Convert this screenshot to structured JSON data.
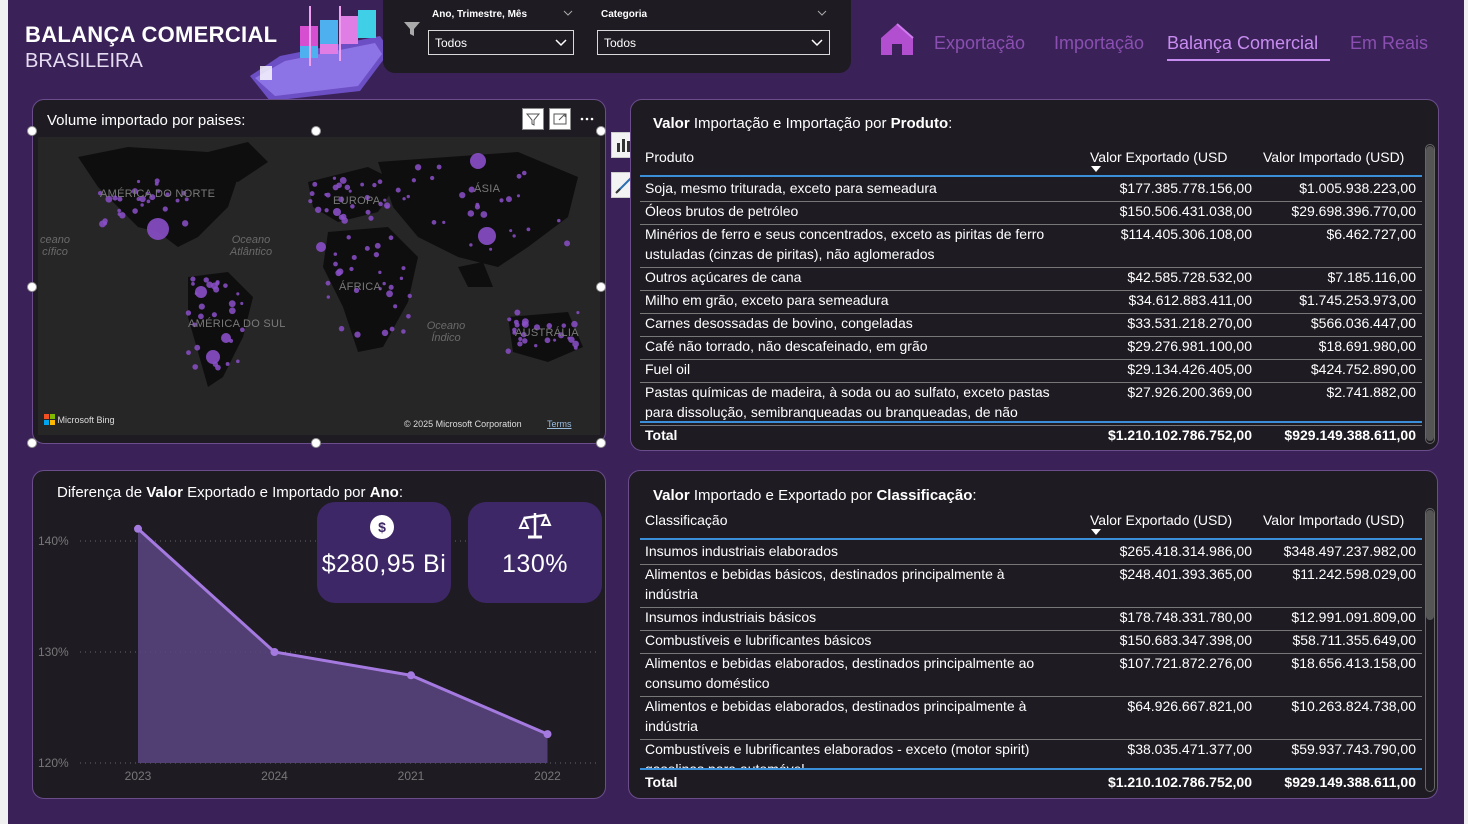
{
  "header": {
    "title_line1": "BALANÇA COMERCIAL",
    "title_line2": "BRASILEIRA"
  },
  "filters": {
    "date_label": "Ano, Trimestre, Mês",
    "date_value": "Todos",
    "category_label": "Categoria",
    "category_value": "Todos"
  },
  "nav": {
    "items": [
      {
        "label": "Exportação",
        "active": false
      },
      {
        "label": "Importação",
        "active": false
      },
      {
        "label": "Balança Comercial",
        "active": true
      },
      {
        "label": "Em Reais",
        "active": false
      }
    ]
  },
  "map": {
    "title": "Volume importado por paises:",
    "labels": [
      "AMÉRICA DO NORTE",
      "EUROPA",
      "ÁSIA",
      "ÁFRICA",
      "AMÉRICA DO SUL",
      "AUSTRÁLIA"
    ],
    "ocean_labels": [
      "Oceano Atlântico",
      "Oceano Índico",
      "ceano cífico"
    ],
    "attribution_bing": "Microsoft Bing",
    "attribution_copyright": "© 2025 Microsoft Corporation",
    "attribution_terms": "Terms",
    "dot_color": "#8a4fc8"
  },
  "products_table": {
    "title_bold1": "Valor",
    "title_mid": " Importação e Importação por ",
    "title_bold2": "Produto",
    "title_end": ":",
    "col_product": "Produto",
    "col_export": "Valor Exportado (USD",
    "col_import": "Valor Importado (USD)",
    "rows": [
      {
        "name": "Soja, mesmo triturada, exceto para semeadura",
        "name2": "",
        "export": "$177.385.778.156,00",
        "import": "$1.005.938.223,00"
      },
      {
        "name": "Óleos brutos de petróleo",
        "name2": "",
        "export": "$150.506.431.038,00",
        "import": "$29.698.396.770,00"
      },
      {
        "name": "Minérios de ferro e seus concentrados, exceto as piritas de ferro",
        "name2": "ustuladas (cinzas de piritas), não aglomerados",
        "export": "$114.405.306.108,00",
        "import": "$6.462.727,00"
      },
      {
        "name": "Outros açúcares de cana",
        "name2": "",
        "export": "$42.585.728.532,00",
        "import": "$7.185.116,00"
      },
      {
        "name": "Milho em grão, exceto para semeadura",
        "name2": "",
        "export": "$34.612.883.411,00",
        "import": "$1.745.253.973,00"
      },
      {
        "name": "Carnes desossadas de bovino, congeladas",
        "name2": "",
        "export": "$33.531.218.270,00",
        "import": "$566.036.447,00"
      },
      {
        "name": "Café não torrado, não descafeinado, em grão",
        "name2": "",
        "export": "$29.276.981.100,00",
        "import": "$18.691.980,00"
      },
      {
        "name": "Fuel oil",
        "name2": "",
        "export": "$29.134.426.405,00",
        "import": "$424.752.890,00"
      },
      {
        "name": "Pastas químicas de madeira, à soda ou ao sulfato, exceto pastas",
        "name2": "para dissolução, semibranqueadas ou branqueadas, de não",
        "export": "$27.926.200.369,00",
        "import": "$2.741.882,00"
      }
    ],
    "total_label": "Total",
    "total_export": "$1.210.102.786.752,00",
    "total_import": "$929.149.388.611,00"
  },
  "class_table": {
    "title_bold1": "Valor",
    "title_mid": " Importado e Exportado por ",
    "title_bold2": "Classificação",
    "title_end": ":",
    "col_class": "Classificação",
    "col_export": "Valor Exportado (USD)",
    "col_import": "Valor Importado (USD)",
    "rows": [
      {
        "name": "Insumos industriais elaborados",
        "name2": "",
        "export": "$265.418.314.986,00",
        "import": "$348.497.237.982,00"
      },
      {
        "name": "Alimentos e bebidas básicos, destinados principalmente à",
        "name2": "indústria",
        "export": "$248.401.393.365,00",
        "import": "$11.242.598.029,00"
      },
      {
        "name": "Insumos industriais básicos",
        "name2": "",
        "export": "$178.748.331.780,00",
        "import": "$12.991.091.809,00"
      },
      {
        "name": "Combustíveis e lubrificantes básicos",
        "name2": "",
        "export": "$150.683.347.398,00",
        "import": "$58.711.355.649,00"
      },
      {
        "name": "Alimentos e bebidas elaborados, destinados principalmente ao",
        "name2": "consumo doméstico",
        "export": "$107.721.872.276,00",
        "import": "$18.656.413.158,00"
      },
      {
        "name": "Alimentos e bebidas elaborados, destinados principalmente à",
        "name2": "indústria",
        "export": "$64.926.667.821,00",
        "import": "$10.263.824.738,00"
      },
      {
        "name": "Combustíveis e lubrificantes elaborados - exceto (motor spirit)",
        "name2": "gasolinas para automóvel",
        "export": "$38.035.471.377,00",
        "import": "$59.937.743.790,00"
      }
    ],
    "total_label": "Total",
    "total_export": "$1.210.102.786.752,00",
    "total_import": "$929.149.388.611,00"
  },
  "diff_chart": {
    "title_pre": "Diferença de ",
    "title_bold1": "Valor",
    "title_mid": " Exportado e Importado  por ",
    "title_bold2": "Ano",
    "title_end": ":",
    "kpi_value": "$280,95 Bi",
    "kpi_value_icon": "dollar-coin-icon",
    "kpi_ratio": "130%",
    "kpi_ratio_icon": "balance-scale-icon"
  },
  "chart_data": {
    "type": "area",
    "title": "Diferença de Valor Exportado e Importado  por Ano:",
    "categories": [
      "2023",
      "2024",
      "2021",
      "2022"
    ],
    "values": [
      141.1,
      130.0,
      127.9,
      122.6
    ],
    "unit": "%",
    "ylim": [
      120,
      140
    ],
    "yticks": [
      120,
      130,
      140
    ],
    "ytick_labels": [
      "120%",
      "130%",
      "140%"
    ],
    "grid": true,
    "line_color": "#a57ae0",
    "fill_color": "#5b4480"
  }
}
